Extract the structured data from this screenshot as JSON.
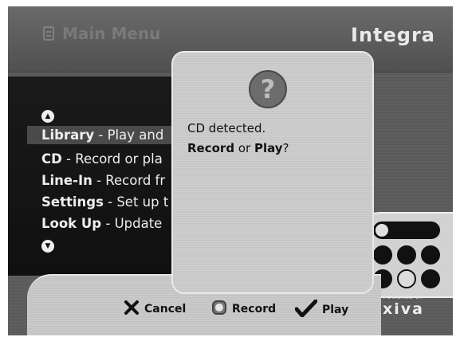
{
  "header": {
    "menu_title": "Main Menu",
    "brand": "Integra"
  },
  "menu": {
    "items": [
      {
        "name": "Library",
        "desc": " - Play and"
      },
      {
        "name": "CD",
        "desc": " - Record or pla"
      },
      {
        "name": "Line-In",
        "desc": " - Record fr"
      },
      {
        "name": "Settings",
        "desc": " - Set up t"
      },
      {
        "name": "Look Up",
        "desc": " - Update"
      }
    ]
  },
  "dialog": {
    "icon": "question-mark-icon",
    "line1": "CD detected.",
    "line2_a": "Record",
    "line2_b": " or ",
    "line2_c": "Play",
    "line2_d": "?"
  },
  "actions": {
    "cancel": "Cancel",
    "record": "Record",
    "play": "Play"
  },
  "footer": {
    "powered_by": "POWERED BY",
    "logo": "xiva"
  },
  "colors": {
    "background": "#5a5a5a",
    "menu_bg": "#111111",
    "dialog_bg": "#c8c8c8",
    "text": "#111111"
  }
}
